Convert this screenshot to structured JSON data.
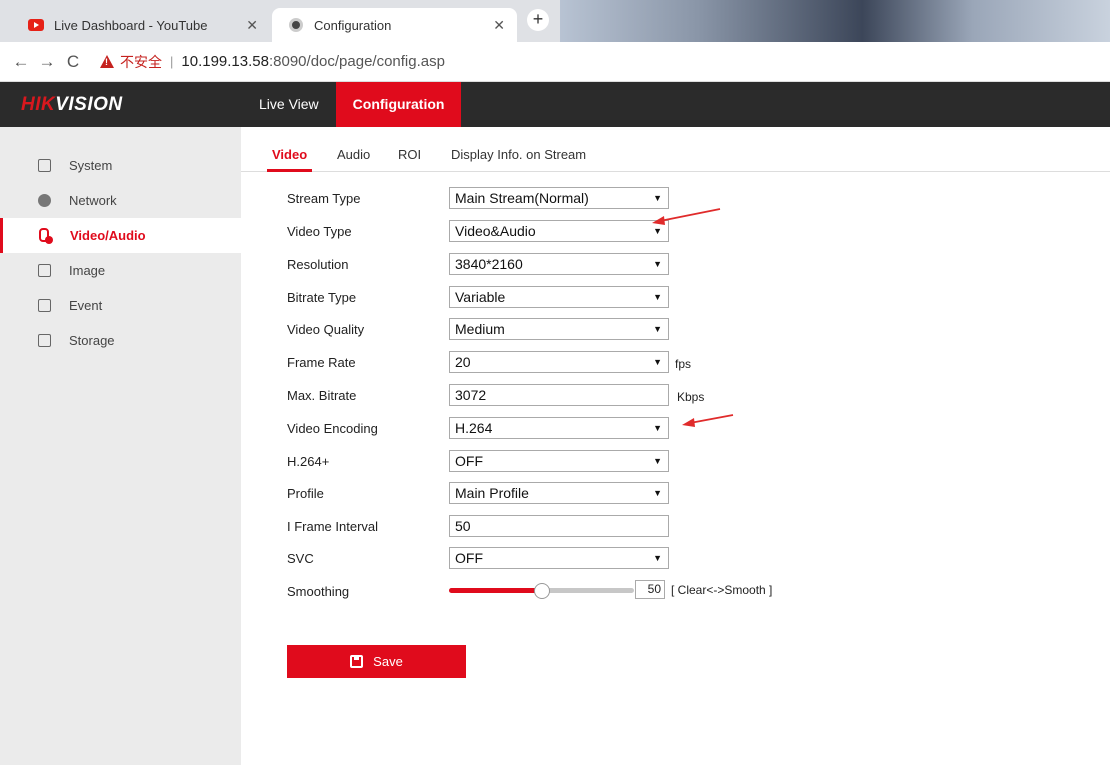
{
  "browser": {
    "tabs": [
      {
        "title": "Live Dashboard - YouTube",
        "icon": "youtube-icon"
      },
      {
        "title": "Configuration",
        "icon": "chrome-icon"
      }
    ],
    "new_tab": "+",
    "security_label": "不安全",
    "url_host": "10.199.13.58",
    "url_rest": ":8090/doc/page/config.asp"
  },
  "header": {
    "logo_hik": "HIK",
    "logo_vision": "VISION",
    "nav": [
      "Live View",
      "Configuration"
    ]
  },
  "sidebar": {
    "items": [
      {
        "label": "System",
        "icon": "monitor-icon"
      },
      {
        "label": "Network",
        "icon": "globe-icon"
      },
      {
        "label": "Video/Audio",
        "icon": "mic-camera-icon"
      },
      {
        "label": "Image",
        "icon": "image-icon"
      },
      {
        "label": "Event",
        "icon": "calendar-icon"
      },
      {
        "label": "Storage",
        "icon": "disk-icon"
      }
    ]
  },
  "subtabs": [
    "Video",
    "Audio",
    "ROI",
    "Display Info. on Stream"
  ],
  "form": {
    "stream_type": {
      "label": "Stream Type",
      "value": "Main Stream(Normal)"
    },
    "video_type": {
      "label": "Video Type",
      "value": "Video&Audio"
    },
    "resolution": {
      "label": "Resolution",
      "value": "3840*2160"
    },
    "bitrate_type": {
      "label": "Bitrate Type",
      "value": "Variable"
    },
    "video_quality": {
      "label": "Video Quality",
      "value": "Medium"
    },
    "frame_rate": {
      "label": "Frame Rate",
      "value": "20",
      "unit": "fps"
    },
    "max_bitrate": {
      "label": "Max. Bitrate",
      "value": "3072",
      "unit": "Kbps"
    },
    "video_encoding": {
      "label": "Video Encoding",
      "value": "H.264"
    },
    "h264plus": {
      "label": "H.264+",
      "value": "OFF"
    },
    "profile": {
      "label": "Profile",
      "value": "Main Profile"
    },
    "i_frame_interval": {
      "label": "I Frame Interval",
      "value": "50"
    },
    "svc": {
      "label": "SVC",
      "value": "OFF"
    },
    "smoothing": {
      "label": "Smoothing",
      "value": "50",
      "hint": "[ Clear<->Smooth ]",
      "level": 0.5
    }
  },
  "dropdown_arrow": "▼",
  "save_label": "Save",
  "colors": {
    "accent": "#e00b1c",
    "header_bg": "#2b2b2b",
    "sidebar_bg": "#ebebeb"
  }
}
